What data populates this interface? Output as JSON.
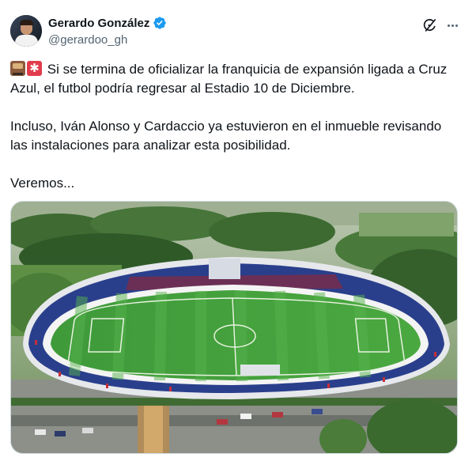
{
  "author": {
    "display_name": "Gerardo González",
    "handle": "@gerardoo_gh",
    "verified": true
  },
  "icons": {
    "grok": "grok-icon",
    "more": "more-icon",
    "verified": "verified-badge-icon",
    "emoji_1": "railway-car-emoji",
    "emoji_2": "rotating-light-emoji"
  },
  "tweet": {
    "line1": "Si se termina de oficializar la franquicia de expansión ligada a Cruz Azul, el futbol podría regresar al Estadio 10 de Diciembre.",
    "line2": "Incluso, Iván Alonso y Cardaccio ya estuvieron en el inmueble revisando las instalaciones para analizar esta posibilidad.",
    "line3": "Veremos..."
  },
  "media": {
    "type": "photo",
    "subject": "aerial-stadium-photo"
  },
  "colors": {
    "text": "#0f1419",
    "secondary": "#536471",
    "verified": "#1d9bf0",
    "pitch": "#3f9a3a"
  }
}
